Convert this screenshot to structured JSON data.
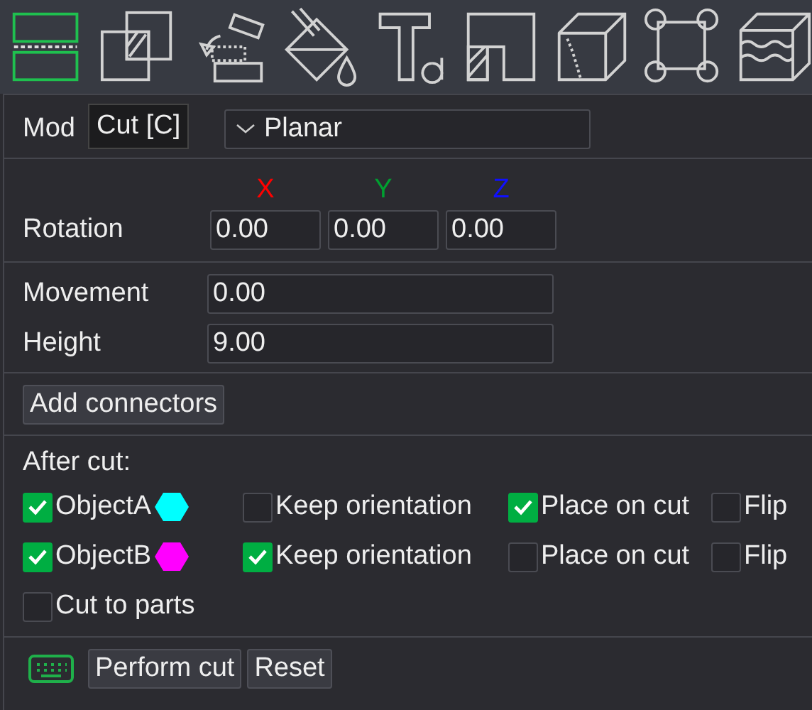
{
  "toolbar": {
    "items": [
      {
        "selected": true
      },
      {
        "selected": false
      },
      {
        "selected": false
      },
      {
        "selected": false
      },
      {
        "selected": false
      },
      {
        "selected": false
      },
      {
        "selected": false
      },
      {
        "selected": false
      },
      {
        "selected": false
      }
    ]
  },
  "tooltip": "Cut [C]",
  "mode": {
    "label": "Mod",
    "value": "Planar"
  },
  "axes": [
    {
      "label": "X",
      "color": "#ff0000"
    },
    {
      "label": "Y",
      "color": "#00a030"
    },
    {
      "label": "Z",
      "color": "#1010ff"
    }
  ],
  "rotation": {
    "label": "Rotation",
    "values": [
      "0.00",
      "0.00",
      "0.00"
    ]
  },
  "movement": {
    "label": "Movement",
    "value": "0.00"
  },
  "height": {
    "label": "Height",
    "value": "9.00"
  },
  "add_connectors": "Add connectors",
  "after_cut": {
    "label": "After cut:",
    "objects": [
      {
        "name": "ObjectA",
        "checked": true,
        "color": "#00ffff",
        "options": [
          {
            "label": "Keep orientation",
            "checked": false
          },
          {
            "label": "Place on cut",
            "checked": true
          },
          {
            "label": "Flip",
            "checked": false
          }
        ]
      },
      {
        "name": "ObjectB",
        "checked": true,
        "color": "#ff00ff",
        "options": [
          {
            "label": "Keep orientation",
            "checked": true
          },
          {
            "label": "Place on cut",
            "checked": false
          },
          {
            "label": "Flip",
            "checked": false
          }
        ]
      }
    ]
  },
  "cut_to_parts": {
    "label": "Cut to parts",
    "checked": false
  },
  "buttons": [
    "Perform cut",
    "Reset"
  ]
}
